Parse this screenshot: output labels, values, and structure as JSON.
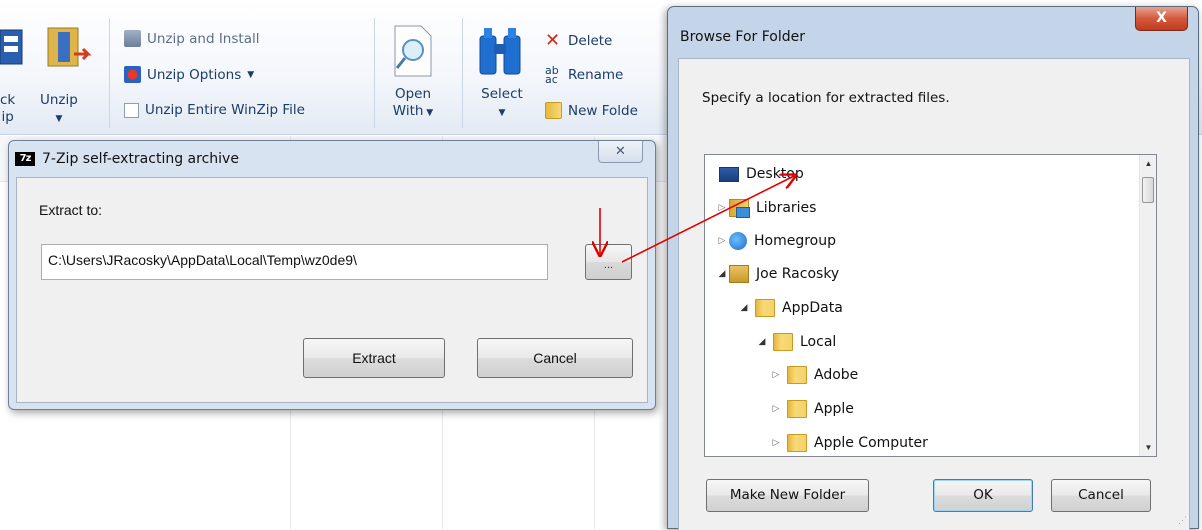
{
  "ribbon": {
    "partial_left_top": "ck",
    "partial_left_bottom": "ip",
    "unzip_label": "Unzip",
    "unzip_and_install": "Unzip and Install",
    "unzip_options": "Unzip Options",
    "unzip_entire": "Unzip Entire WinZip File",
    "open_with_line1": "Open",
    "open_with_line2": "With",
    "select": "Select",
    "delete": "Delete",
    "rename": "Rename",
    "new_folder": "New Folde"
  },
  "zip_dialog": {
    "title": "7-Zip self-extracting archive",
    "icon_text": "7z",
    "extract_to_label": "Extract to:",
    "path_value": "C:\\Users\\JRacosky\\AppData\\Local\\Temp\\wz0de9\\",
    "browse_label": "...",
    "extract_button": "Extract",
    "cancel_button": "Cancel",
    "close_glyph": "✕"
  },
  "browse_dialog": {
    "title": "Browse For Folder",
    "close_glyph": "X",
    "instruction": "Specify a location for extracted files.",
    "tree": [
      {
        "label": "Desktop",
        "icon": "desktop-icon",
        "level": 0,
        "toggle": ""
      },
      {
        "label": "Libraries",
        "icon": "libraries-icon",
        "level": 0,
        "toggle": "▷"
      },
      {
        "label": "Homegroup",
        "icon": "homegroup-icon",
        "level": 0,
        "toggle": "▷"
      },
      {
        "label": "Joe Racosky",
        "icon": "user-folder-icon",
        "level": 0,
        "toggle": "◢"
      },
      {
        "label": "AppData",
        "icon": "folder-icon",
        "level": 1,
        "toggle": "◢"
      },
      {
        "label": "Local",
        "icon": "folder-icon",
        "level": 2,
        "toggle": "◢"
      },
      {
        "label": "Adobe",
        "icon": "folder-icon",
        "level": 3,
        "toggle": "▷"
      },
      {
        "label": "Apple",
        "icon": "folder-icon",
        "level": 3,
        "toggle": "▷"
      },
      {
        "label": "Apple Computer",
        "icon": "folder-icon",
        "level": 3,
        "toggle": "▷"
      }
    ],
    "make_new_folder": "Make New Folder",
    "ok": "OK",
    "cancel": "Cancel"
  },
  "colors": {
    "annotation_arrow": "#e00000",
    "zip_frame": "#d8e3f1",
    "browse_frame": "#c4d5ea",
    "close_button_red": "#c23b1f"
  }
}
